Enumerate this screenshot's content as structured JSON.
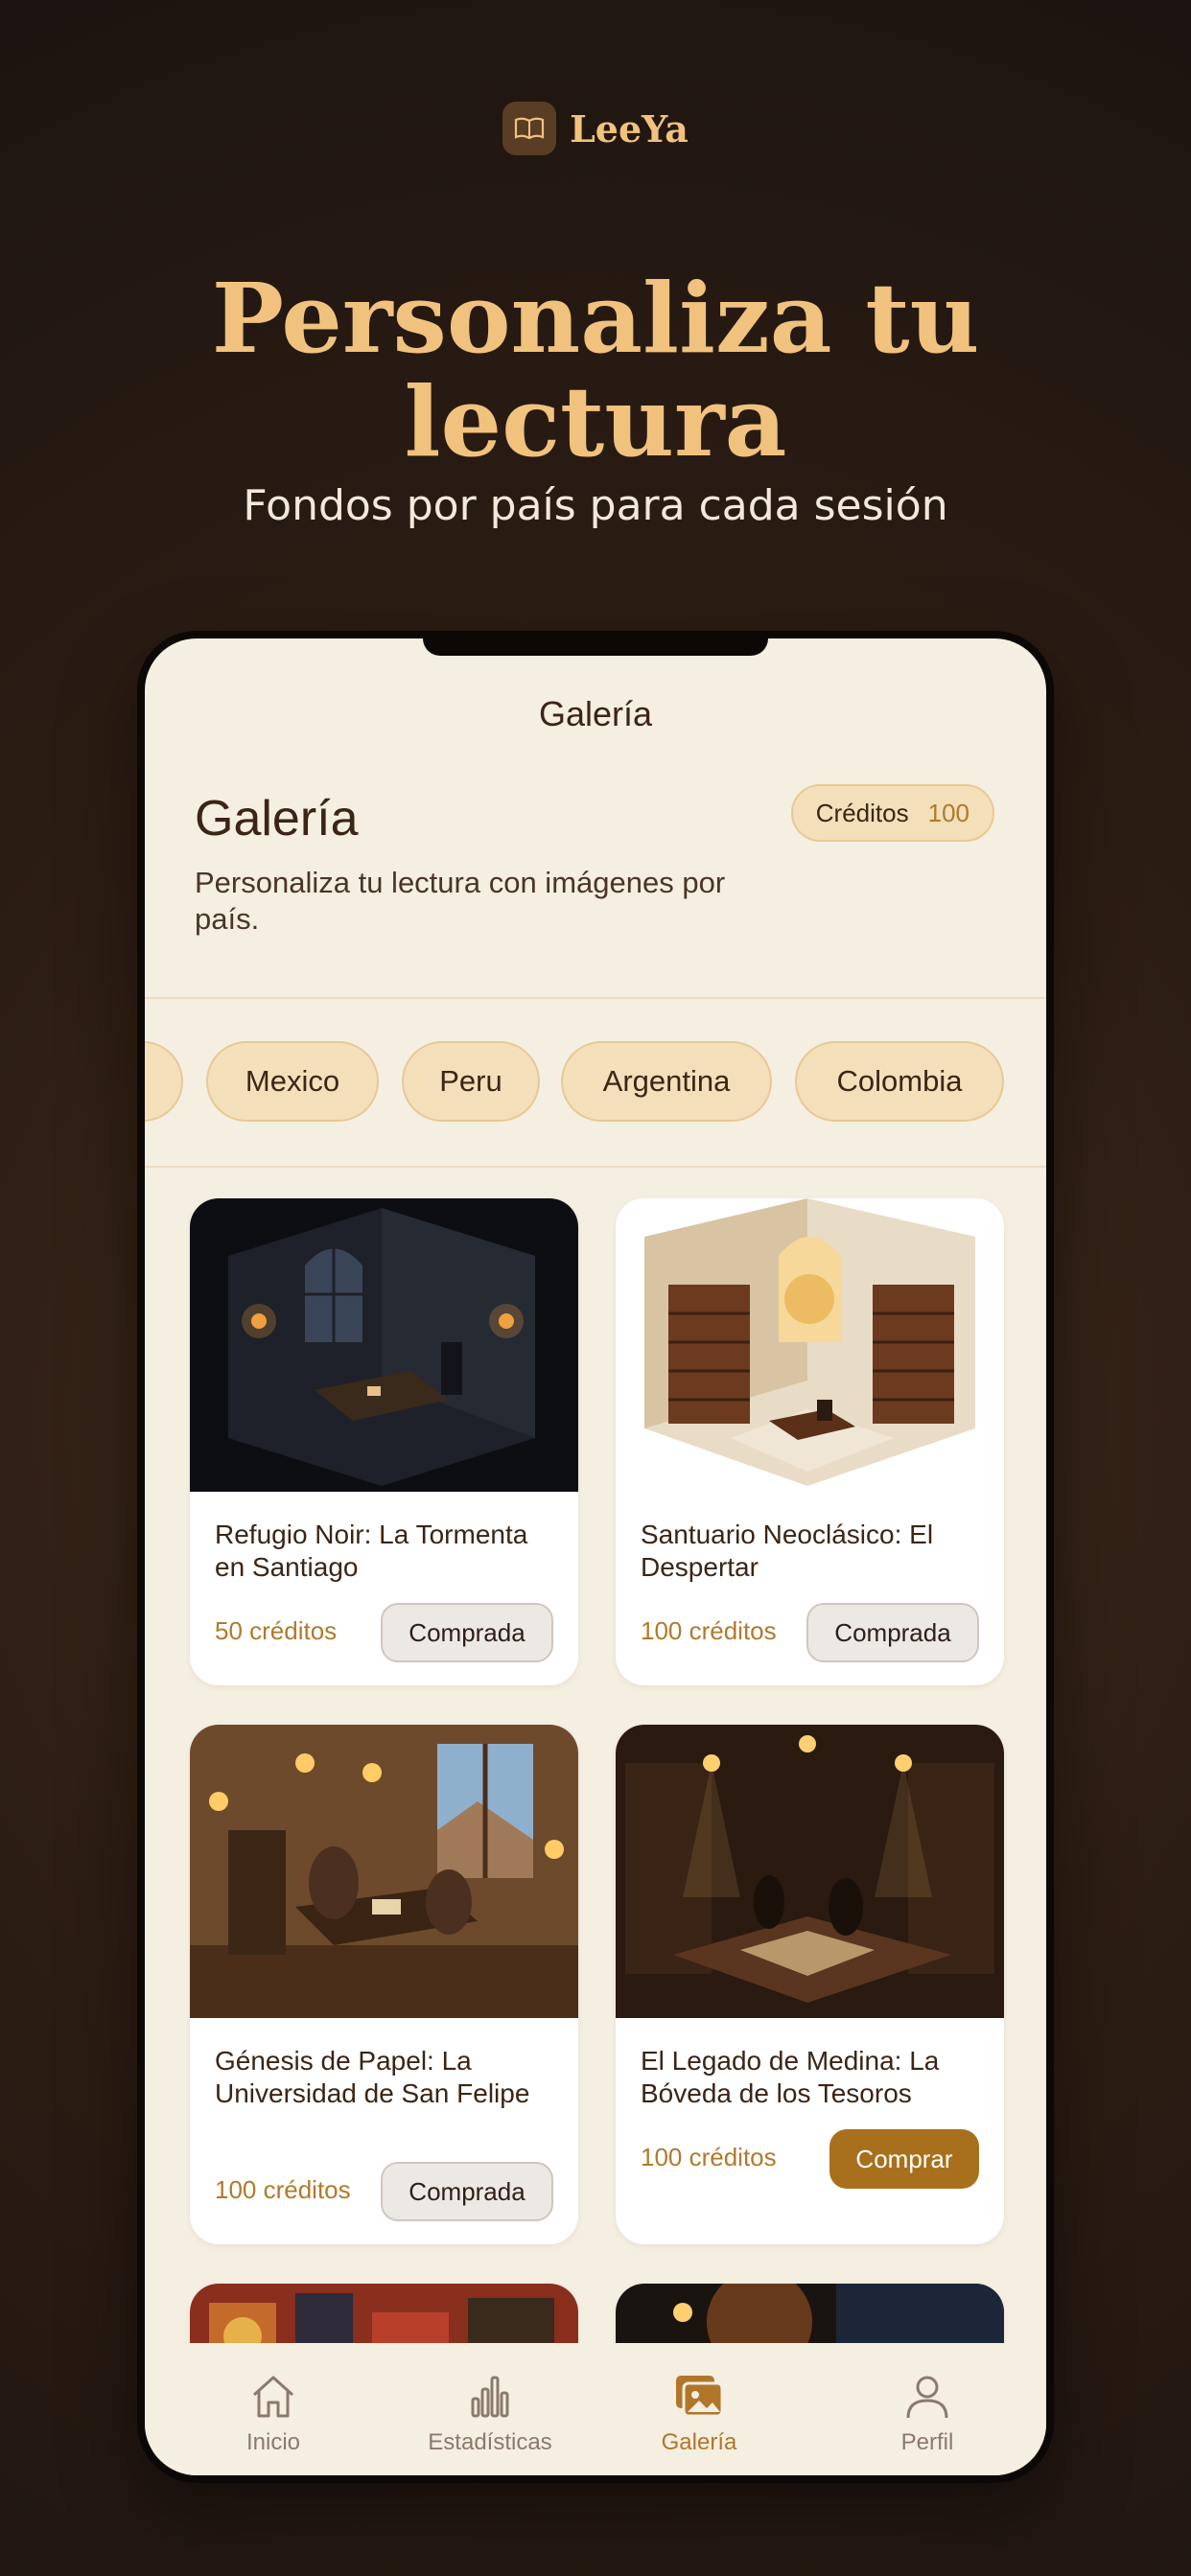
{
  "brand": {
    "name": "LeeYa",
    "icon": "book-icon"
  },
  "hero": {
    "title_line1": "Personaliza tu",
    "title_line2": "lectura",
    "subtitle": "Fondos por país para cada sesión"
  },
  "header": {
    "title": "Galería"
  },
  "gallery": {
    "title": "Galería",
    "description": "Personaliza tu lectura con imágenes por país."
  },
  "credits": {
    "label": "Créditos",
    "value": "100"
  },
  "countries": [
    "Mexico",
    "Peru",
    "Argentina",
    "Colombia"
  ],
  "cards": [
    {
      "title": "Refugio Noir: La Tormenta en Santiago",
      "price": "50 créditos",
      "action": "Comprada",
      "status": "owned"
    },
    {
      "title": "Santuario Neoclásico: El Despertar",
      "price": "100 créditos",
      "action": "Comprada",
      "status": "owned"
    },
    {
      "title": "Génesis de Papel: La Universidad de San Felipe",
      "price": "100 créditos",
      "action": "Comprada",
      "status": "owned"
    },
    {
      "title": "El Legado de Medina: La Bóveda de los Tesoros",
      "price": "100 créditos",
      "action": "Comprar",
      "status": "available"
    }
  ],
  "tabs": [
    {
      "label": "Inicio",
      "icon": "home-icon"
    },
    {
      "label": "Estadísticas",
      "icon": "bar-chart-icon"
    },
    {
      "label": "Galería",
      "icon": "gallery-icon",
      "active": true
    },
    {
      "label": "Perfil",
      "icon": "user-icon"
    }
  ],
  "colors": {
    "accent": "#b0762a",
    "gold": "#f1c27d",
    "background": "#2e1e14",
    "surface": "#f5efe2",
    "buy_button": "#a8701c"
  }
}
